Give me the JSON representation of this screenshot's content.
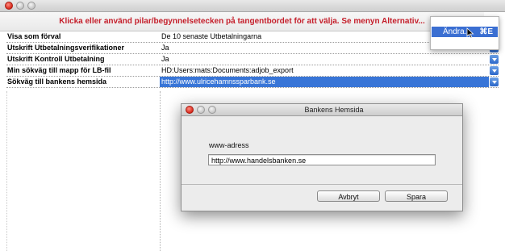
{
  "hint": "Klicka eller använd pilar/begynnelsetecken på tangentbordet för att välja. Se menyn Alternativ...",
  "rows": [
    {
      "label": "Visa som förval",
      "value": "De 10 senaste Utbetalningarna"
    },
    {
      "label": "Utskrift Utbetalningsverifikationer",
      "value": "Ja"
    },
    {
      "label": "Utskrift Kontroll Utbetalning",
      "value": "Ja"
    },
    {
      "label": "Min sökväg till mapp för LB-fil",
      "value": "HD:Users:mats:Documents:adjob_export"
    },
    {
      "label": "Sökväg till bankens hemsida",
      "value": "http://www.ulricehamnssparbank.se"
    }
  ],
  "popup_menu": {
    "item_label": "Ändra...",
    "shortcut": "⌘E"
  },
  "dialog": {
    "title": "Bankens Hemsida",
    "field_label": "www-adress",
    "field_value": "http://www.handelsbanken.se",
    "cancel_label": "Avbryt",
    "save_label": "Spara"
  },
  "colors": {
    "hint_text": "#c41e2a",
    "selection": "#3875d7",
    "accent": "#3b6fd2"
  },
  "icons": [
    "close-icon",
    "minimize-icon",
    "zoom-icon",
    "dropdown-arrow-icon",
    "pointer-cursor-icon"
  ]
}
